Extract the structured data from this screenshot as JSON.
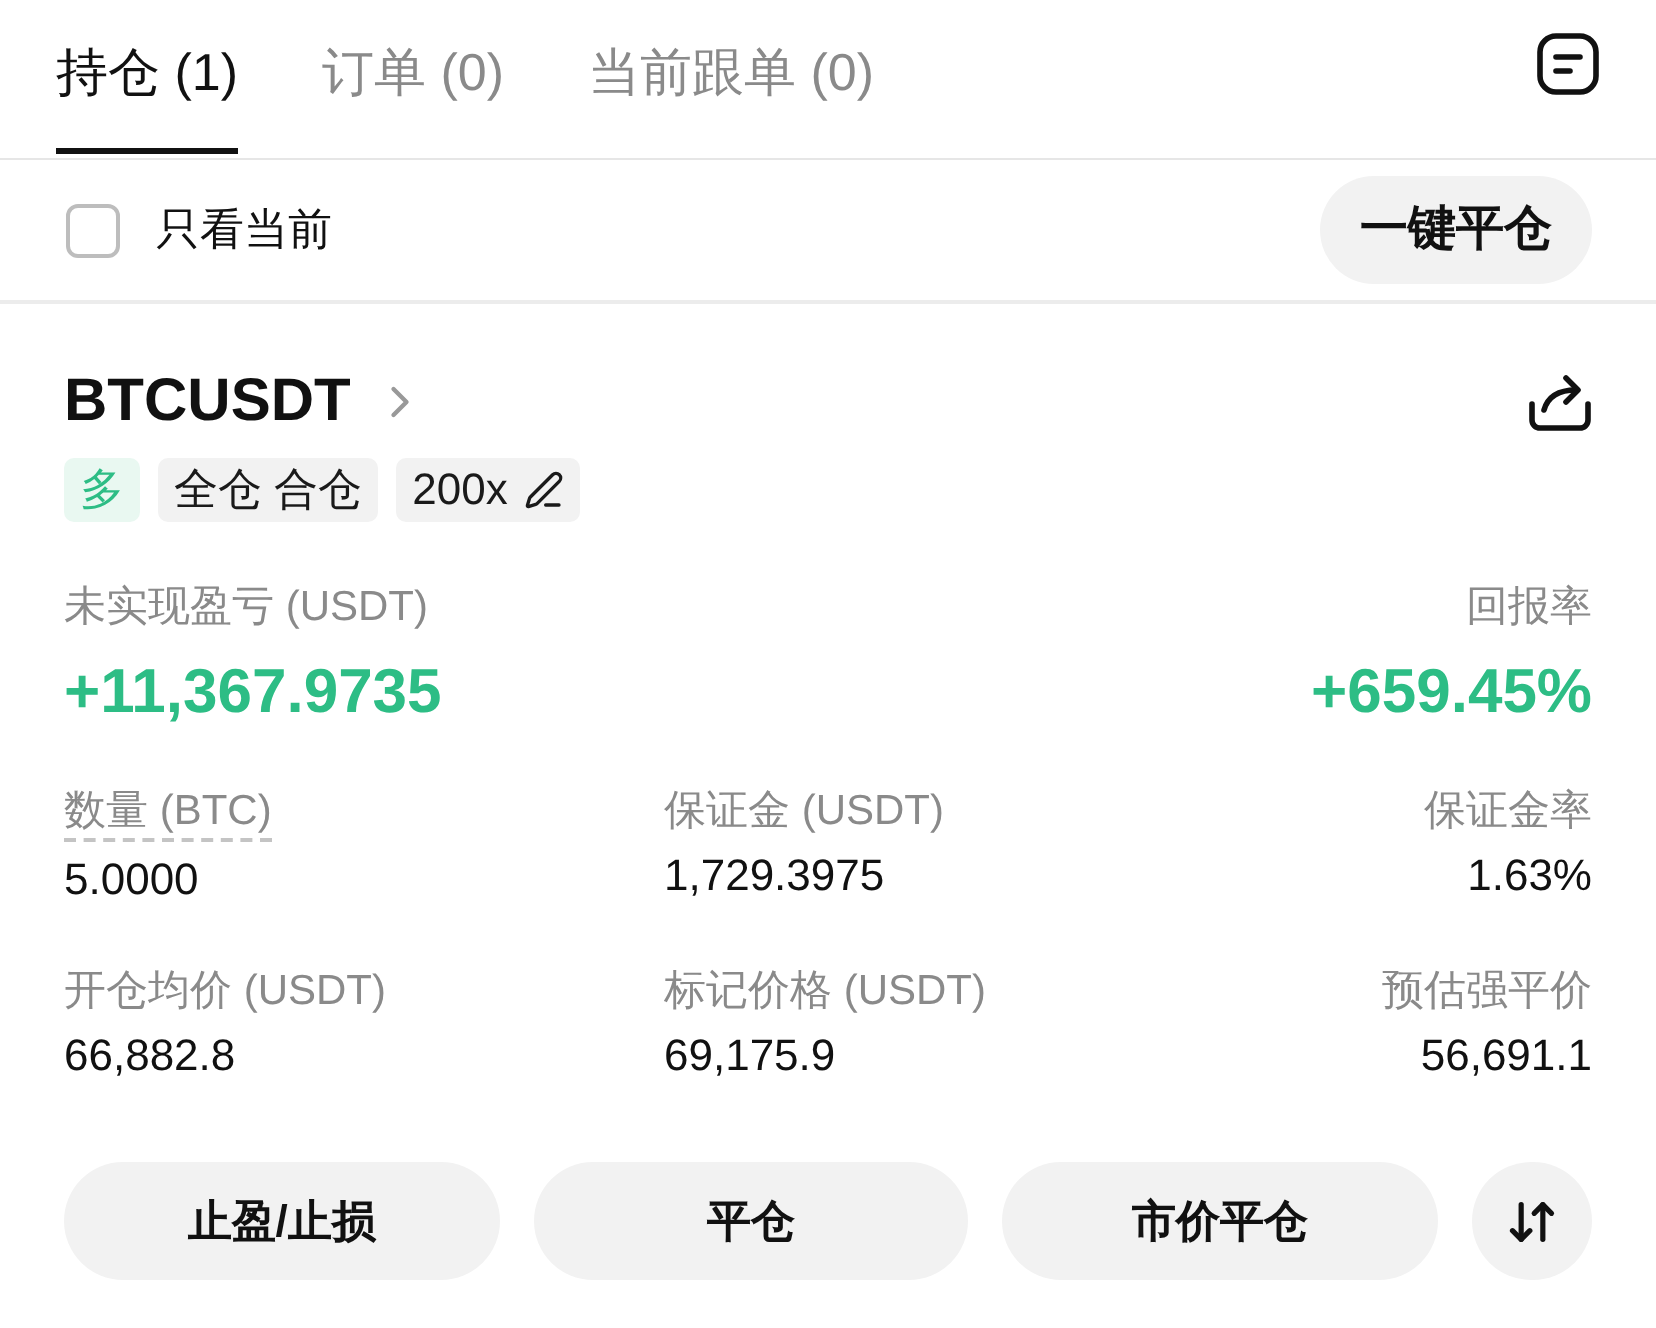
{
  "tabs": [
    {
      "label": "持仓 (1)",
      "selected": true
    },
    {
      "label": "订单 (0)",
      "selected": false
    },
    {
      "label": "当前跟单 (0)",
      "selected": false
    }
  ],
  "filter": {
    "label": "只看当前",
    "checked": false
  },
  "close_all_button": "一键平仓",
  "position": {
    "symbol": "BTCUSDT",
    "tags": [
      {
        "kind": "side",
        "label": "多"
      },
      {
        "kind": "plain",
        "label": "全仓 合仓"
      },
      {
        "kind": "leverage",
        "label": "200x"
      }
    ],
    "pnl": {
      "label": "未实现盈亏 (USDT)",
      "value": "+11,367.9735"
    },
    "roi": {
      "label": "回报率",
      "value": "+659.45%"
    },
    "fields": [
      {
        "label": "数量 (BTC)",
        "value": "5.0000",
        "underlined": true
      },
      {
        "label": "保证金 (USDT)",
        "value": "1,729.3975",
        "underlined": false
      },
      {
        "label": "保证金率",
        "value": "1.63%",
        "underlined": false
      },
      {
        "label": "开仓均价 (USDT)",
        "value": "66,882.8",
        "underlined": false
      },
      {
        "label": "标记价格 (USDT)",
        "value": "69,175.9",
        "underlined": false
      },
      {
        "label": "预估强平价",
        "value": "56,691.1",
        "underlined": false
      }
    ]
  },
  "actions": [
    "止盈/止损",
    "平仓",
    "市价平仓"
  ]
}
